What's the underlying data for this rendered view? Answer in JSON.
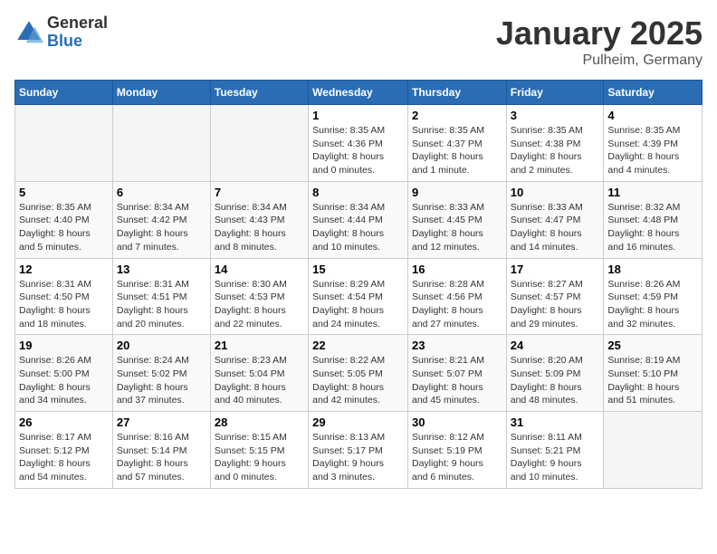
{
  "logo": {
    "general": "General",
    "blue": "Blue"
  },
  "title": "January 2025",
  "location": "Pulheim, Germany",
  "weekdays": [
    "Sunday",
    "Monday",
    "Tuesday",
    "Wednesday",
    "Thursday",
    "Friday",
    "Saturday"
  ],
  "weeks": [
    [
      {
        "day": "",
        "info": ""
      },
      {
        "day": "",
        "info": ""
      },
      {
        "day": "",
        "info": ""
      },
      {
        "day": "1",
        "info": "Sunrise: 8:35 AM\nSunset: 4:36 PM\nDaylight: 8 hours\nand 0 minutes."
      },
      {
        "day": "2",
        "info": "Sunrise: 8:35 AM\nSunset: 4:37 PM\nDaylight: 8 hours\nand 1 minute."
      },
      {
        "day": "3",
        "info": "Sunrise: 8:35 AM\nSunset: 4:38 PM\nDaylight: 8 hours\nand 2 minutes."
      },
      {
        "day": "4",
        "info": "Sunrise: 8:35 AM\nSunset: 4:39 PM\nDaylight: 8 hours\nand 4 minutes."
      }
    ],
    [
      {
        "day": "5",
        "info": "Sunrise: 8:35 AM\nSunset: 4:40 PM\nDaylight: 8 hours\nand 5 minutes."
      },
      {
        "day": "6",
        "info": "Sunrise: 8:34 AM\nSunset: 4:42 PM\nDaylight: 8 hours\nand 7 minutes."
      },
      {
        "day": "7",
        "info": "Sunrise: 8:34 AM\nSunset: 4:43 PM\nDaylight: 8 hours\nand 8 minutes."
      },
      {
        "day": "8",
        "info": "Sunrise: 8:34 AM\nSunset: 4:44 PM\nDaylight: 8 hours\nand 10 minutes."
      },
      {
        "day": "9",
        "info": "Sunrise: 8:33 AM\nSunset: 4:45 PM\nDaylight: 8 hours\nand 12 minutes."
      },
      {
        "day": "10",
        "info": "Sunrise: 8:33 AM\nSunset: 4:47 PM\nDaylight: 8 hours\nand 14 minutes."
      },
      {
        "day": "11",
        "info": "Sunrise: 8:32 AM\nSunset: 4:48 PM\nDaylight: 8 hours\nand 16 minutes."
      }
    ],
    [
      {
        "day": "12",
        "info": "Sunrise: 8:31 AM\nSunset: 4:50 PM\nDaylight: 8 hours\nand 18 minutes."
      },
      {
        "day": "13",
        "info": "Sunrise: 8:31 AM\nSunset: 4:51 PM\nDaylight: 8 hours\nand 20 minutes."
      },
      {
        "day": "14",
        "info": "Sunrise: 8:30 AM\nSunset: 4:53 PM\nDaylight: 8 hours\nand 22 minutes."
      },
      {
        "day": "15",
        "info": "Sunrise: 8:29 AM\nSunset: 4:54 PM\nDaylight: 8 hours\nand 24 minutes."
      },
      {
        "day": "16",
        "info": "Sunrise: 8:28 AM\nSunset: 4:56 PM\nDaylight: 8 hours\nand 27 minutes."
      },
      {
        "day": "17",
        "info": "Sunrise: 8:27 AM\nSunset: 4:57 PM\nDaylight: 8 hours\nand 29 minutes."
      },
      {
        "day": "18",
        "info": "Sunrise: 8:26 AM\nSunset: 4:59 PM\nDaylight: 8 hours\nand 32 minutes."
      }
    ],
    [
      {
        "day": "19",
        "info": "Sunrise: 8:26 AM\nSunset: 5:00 PM\nDaylight: 8 hours\nand 34 minutes."
      },
      {
        "day": "20",
        "info": "Sunrise: 8:24 AM\nSunset: 5:02 PM\nDaylight: 8 hours\nand 37 minutes."
      },
      {
        "day": "21",
        "info": "Sunrise: 8:23 AM\nSunset: 5:04 PM\nDaylight: 8 hours\nand 40 minutes."
      },
      {
        "day": "22",
        "info": "Sunrise: 8:22 AM\nSunset: 5:05 PM\nDaylight: 8 hours\nand 42 minutes."
      },
      {
        "day": "23",
        "info": "Sunrise: 8:21 AM\nSunset: 5:07 PM\nDaylight: 8 hours\nand 45 minutes."
      },
      {
        "day": "24",
        "info": "Sunrise: 8:20 AM\nSunset: 5:09 PM\nDaylight: 8 hours\nand 48 minutes."
      },
      {
        "day": "25",
        "info": "Sunrise: 8:19 AM\nSunset: 5:10 PM\nDaylight: 8 hours\nand 51 minutes."
      }
    ],
    [
      {
        "day": "26",
        "info": "Sunrise: 8:17 AM\nSunset: 5:12 PM\nDaylight: 8 hours\nand 54 minutes."
      },
      {
        "day": "27",
        "info": "Sunrise: 8:16 AM\nSunset: 5:14 PM\nDaylight: 8 hours\nand 57 minutes."
      },
      {
        "day": "28",
        "info": "Sunrise: 8:15 AM\nSunset: 5:15 PM\nDaylight: 9 hours\nand 0 minutes."
      },
      {
        "day": "29",
        "info": "Sunrise: 8:13 AM\nSunset: 5:17 PM\nDaylight: 9 hours\nand 3 minutes."
      },
      {
        "day": "30",
        "info": "Sunrise: 8:12 AM\nSunset: 5:19 PM\nDaylight: 9 hours\nand 6 minutes."
      },
      {
        "day": "31",
        "info": "Sunrise: 8:11 AM\nSunset: 5:21 PM\nDaylight: 9 hours\nand 10 minutes."
      },
      {
        "day": "",
        "info": ""
      }
    ]
  ]
}
